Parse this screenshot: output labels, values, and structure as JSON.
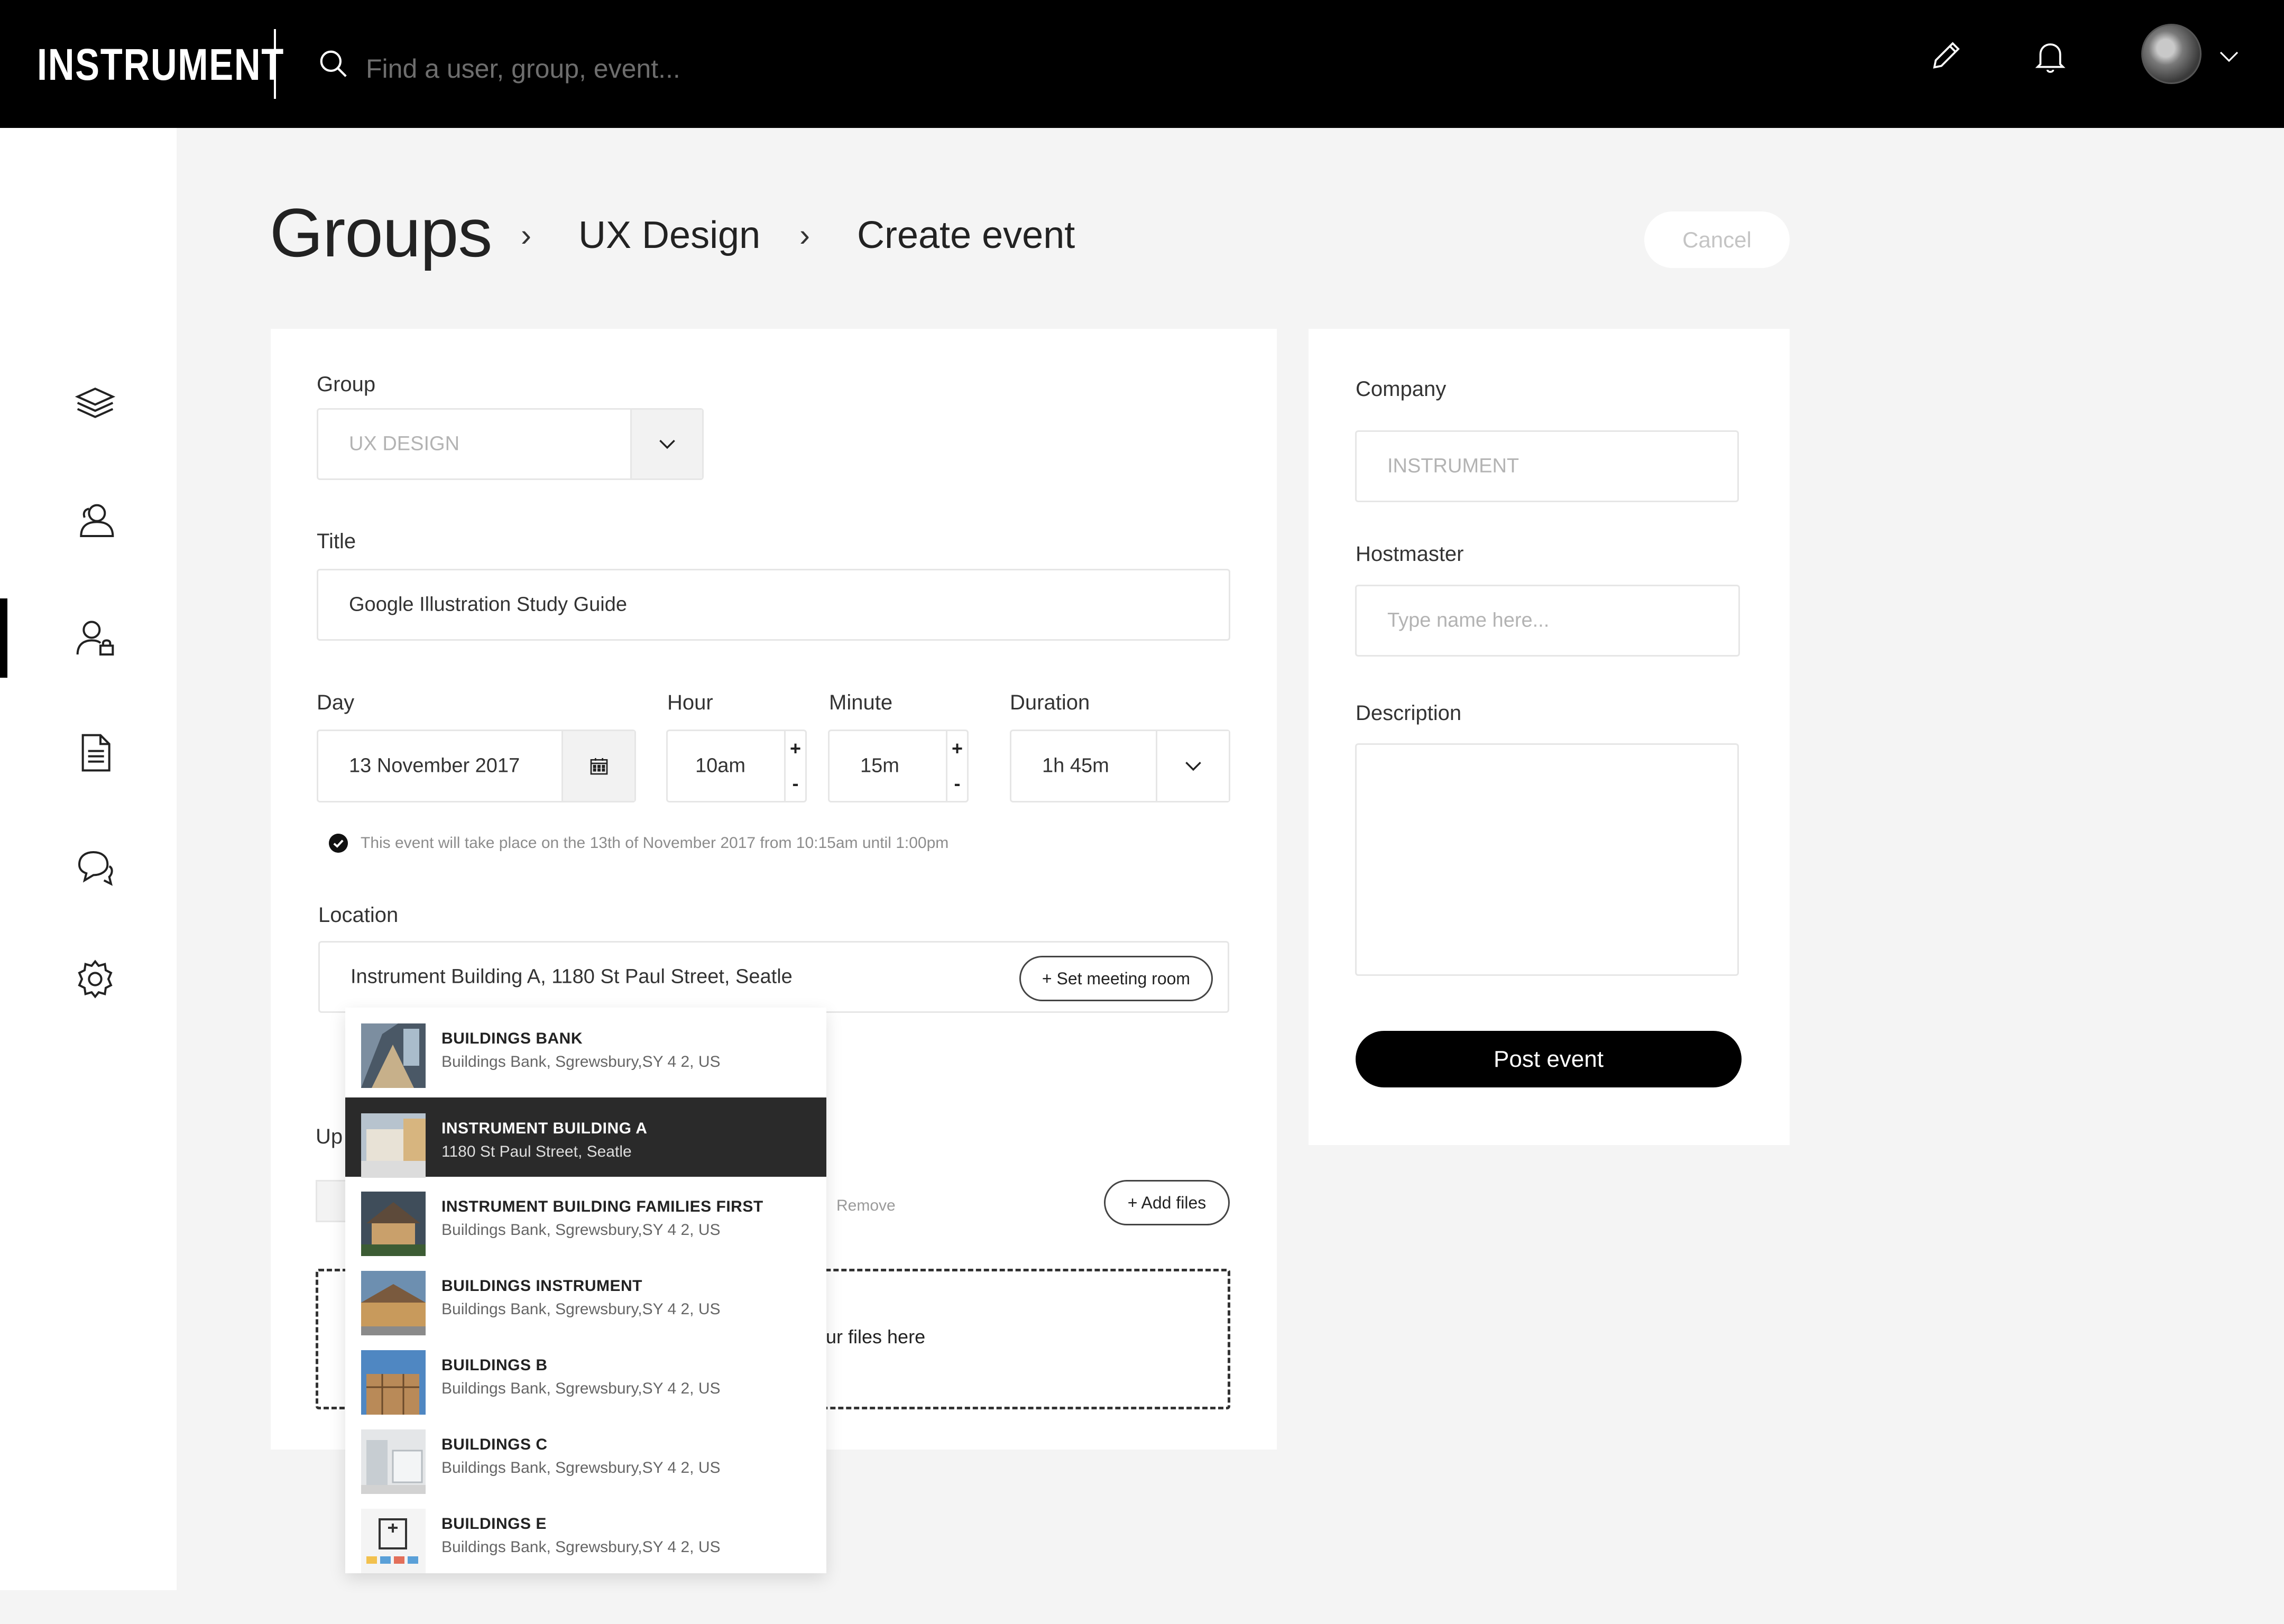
{
  "topbar": {
    "logo": "INSTRUMENT",
    "search_placeholder": "Find a user, group, event..."
  },
  "breadcrumb": {
    "root": "Groups",
    "group": "UX Design",
    "page": "Create event",
    "separator": "›"
  },
  "cancel_label": "Cancel",
  "form": {
    "group_label": "Group",
    "group_value": "UX DESIGN",
    "title_label": "Title",
    "title_value": "Google Illustration Study Guide",
    "day_label": "Day",
    "day_value": "13 November 2017",
    "hour_label": "Hour",
    "hour_value": "10am",
    "minute_label": "Minute",
    "minute_value": "15m",
    "duration_label": "Duration",
    "duration_value": "1h 45m",
    "stepper_plus": "+",
    "stepper_minus": "-",
    "note": "This event will take place on the 13th of November 2017 from 10:15am until 1:00pm",
    "location_label": "Location",
    "location_value": "Instrument Building A, 1180 St Paul Street, Seatle",
    "set_room_label": "+ Set meeting room",
    "upload_label": "Up",
    "remove_label": "Remove",
    "add_files_label": "+ Add files",
    "dropzone_text": "ur files here"
  },
  "side_form": {
    "company_label": "Company",
    "company_value": "INSTRUMENT",
    "hostmaster_label": "Hostmaster",
    "hostmaster_placeholder": "Type  name here...",
    "description_label": "Description",
    "post_label": "Post event"
  },
  "location_options": [
    {
      "name": "BUILDINGS BANK",
      "address": "Buildings Bank, Sgrewsbury,SY 4 2, US",
      "selected": false
    },
    {
      "name": "INSTRUMENT BUILDING A",
      "address": "1180 St Paul Street, Seatle",
      "selected": true
    },
    {
      "name": "INSTRUMENT BUILDING FAMILIES FIRST",
      "address": "Buildings Bank, Sgrewsbury,SY 4 2, US",
      "selected": false
    },
    {
      "name": "BUILDINGS INSTRUMENT",
      "address": "Buildings Bank, Sgrewsbury,SY 4 2, US",
      "selected": false
    },
    {
      "name": "BUILDINGS B",
      "address": "Buildings Bank, Sgrewsbury,SY 4 2, US",
      "selected": false
    },
    {
      "name": "BUILDINGS C",
      "address": "Buildings Bank, Sgrewsbury,SY 4 2, US",
      "selected": false
    },
    {
      "name": "BUILDINGS E",
      "address": "Buildings Bank, Sgrewsbury,SY 4 2, US",
      "selected": false
    }
  ],
  "sidebar": {
    "items": [
      {
        "icon": "layers-icon"
      },
      {
        "icon": "users-icon"
      },
      {
        "icon": "user-lock-icon",
        "active": true
      },
      {
        "icon": "document-icon"
      },
      {
        "icon": "chat-icon"
      },
      {
        "icon": "gear-icon"
      }
    ]
  }
}
